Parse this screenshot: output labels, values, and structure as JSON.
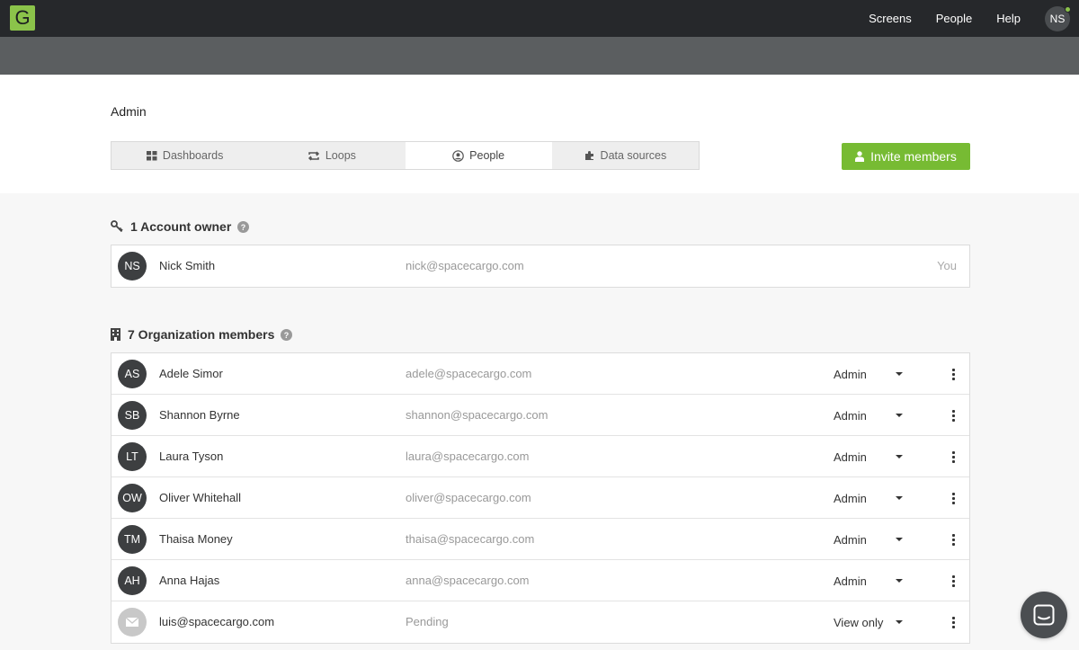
{
  "topbar": {
    "logo_letter": "G",
    "nav": [
      "Screens",
      "People",
      "Help"
    ],
    "user_initials": "NS"
  },
  "page": {
    "title": "Admin",
    "tabs": [
      {
        "label": "Dashboards",
        "icon": "grid-icon"
      },
      {
        "label": "Loops",
        "icon": "loop-icon"
      },
      {
        "label": "People",
        "icon": "user-circle-icon",
        "active": true
      },
      {
        "label": "Data sources",
        "icon": "puzzle-icon"
      }
    ],
    "invite_label": "Invite members"
  },
  "owner_section": {
    "title": "1 Account owner",
    "rows": [
      {
        "initials": "NS",
        "name": "Nick Smith",
        "email": "nick@spacecargo.com",
        "tag": "You"
      }
    ]
  },
  "members_section": {
    "title": "7 Organization members",
    "rows": [
      {
        "initials": "AS",
        "name": "Adele Simor",
        "email": "adele@spacecargo.com",
        "role": "Admin"
      },
      {
        "initials": "SB",
        "name": "Shannon Byrne",
        "email": "shannon@spacecargo.com",
        "role": "Admin"
      },
      {
        "initials": "LT",
        "name": "Laura Tyson",
        "email": "laura@spacecargo.com",
        "role": "Admin"
      },
      {
        "initials": "OW",
        "name": "Oliver Whitehall",
        "email": "oliver@spacecargo.com",
        "role": "Admin"
      },
      {
        "initials": "TM",
        "name": "Thaisa Money",
        "email": "thaisa@spacecargo.com",
        "role": "Admin"
      },
      {
        "initials": "AH",
        "name": "Anna Hajas",
        "email": "anna@spacecargo.com",
        "role": "Admin"
      },
      {
        "initials": "",
        "name": "luis@spacecargo.com",
        "email": "Pending",
        "role": "View only",
        "pending": true
      }
    ]
  },
  "colors": {
    "topbar": "#26282b",
    "accent_green": "#77bb33",
    "avatar": "#3d3f41"
  }
}
